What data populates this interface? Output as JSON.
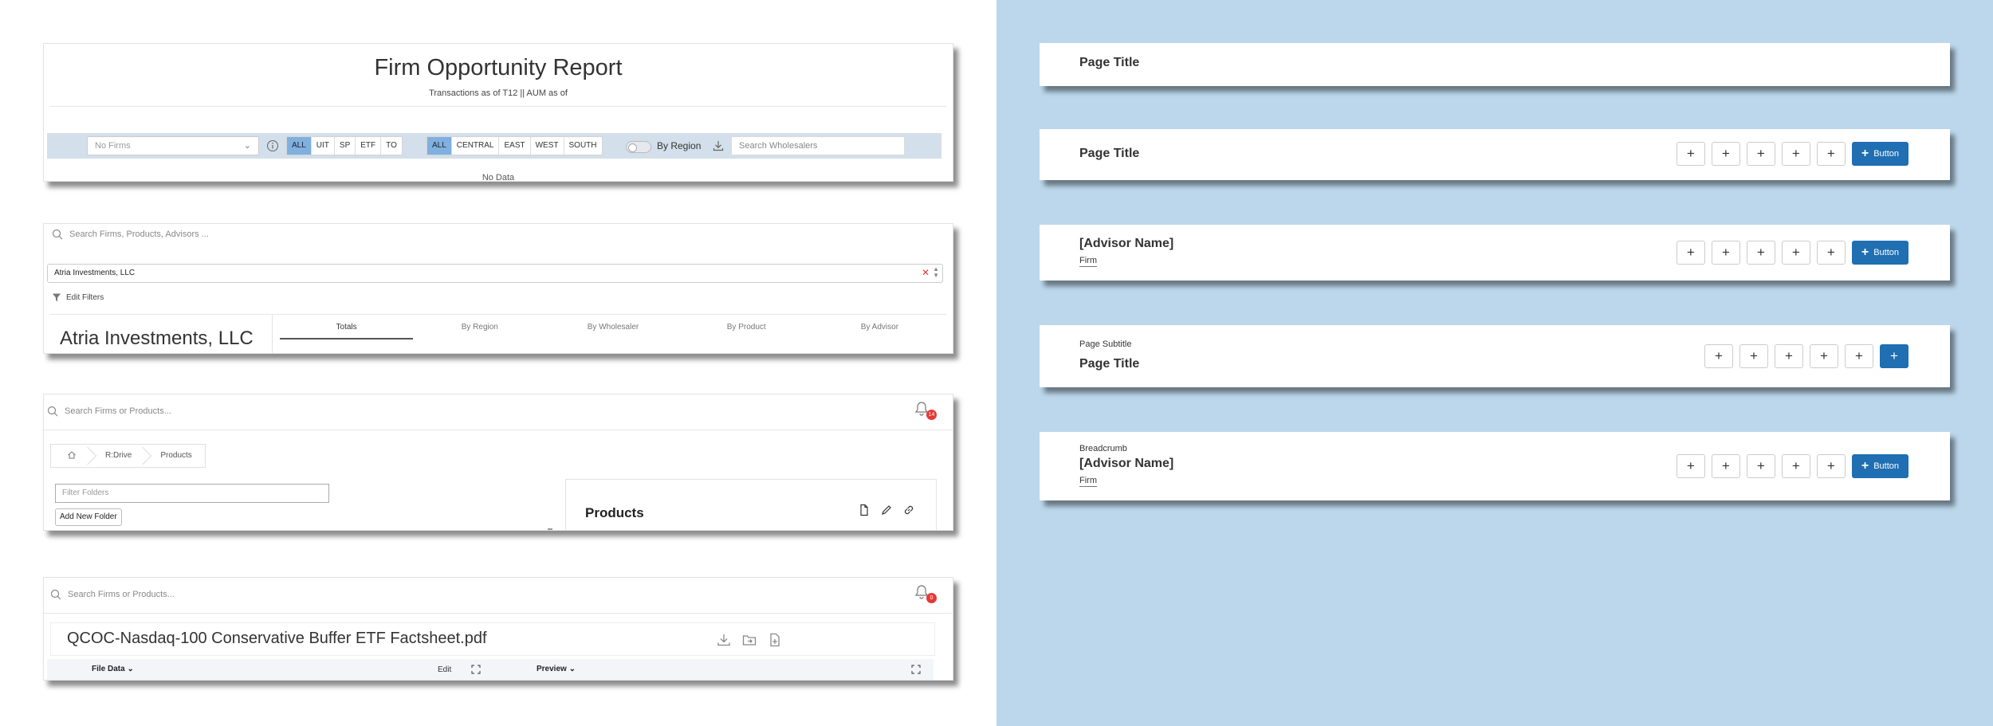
{
  "report": {
    "title": "Firm Opportunity Report",
    "subtitle": "Transactions as of T12 || AUM as of",
    "firm_select_placeholder": "No Firms",
    "product_filters": [
      "ALL",
      "UIT",
      "SP",
      "ETF",
      "TO"
    ],
    "region_filters": [
      "ALL",
      "CENTRAL",
      "EAST",
      "WEST",
      "SOUTH"
    ],
    "by_region_label": "By Region",
    "wholesaler_search_placeholder": "Search Wholesalers",
    "no_data": "No Data"
  },
  "firm_view": {
    "search_placeholder": "Search Firms, Products, Advisors ...",
    "selected_firm": "Atria Investments, LLC",
    "edit_filters": "Edit Filters",
    "firm_name": "Atria Investments, LLC",
    "tabs": [
      "Totals",
      "By Region",
      "By Wholesaler",
      "By Product",
      "By Advisor"
    ]
  },
  "drive": {
    "search_placeholder": "Search Firms or Products...",
    "notification_count": "14",
    "breadcrumbs": [
      "R:Drive",
      "Products"
    ],
    "filter_placeholder": "Filter Folders",
    "add_folder": "Add New Folder",
    "panel_title": "Products"
  },
  "file_view": {
    "search_placeholder": "Search Firms or Products...",
    "notification_count": "0",
    "file_name": "QCOC-Nasdaq-100 Conservative Buffer ETF Factsheet.pdf",
    "file_data": "File Data",
    "edit": "Edit",
    "preview": "Preview"
  },
  "headers": {
    "h1": {
      "title": "Page Title"
    },
    "h2": {
      "title": "Page Title",
      "button": "Button"
    },
    "h3": {
      "title": "[Advisor Name]",
      "firm": "Firm",
      "button": "Button"
    },
    "h4": {
      "subtitle": "Page Subtitle",
      "title": "Page Title"
    },
    "h5": {
      "breadcrumb": "Breadcrumb",
      "title": "[Advisor Name]",
      "firm": "Firm",
      "button": "Button"
    },
    "plus_symbol": "+"
  },
  "colors": {
    "right_background": "#bcd7ec",
    "primary_button": "#1f6fb2",
    "active_filter": "#7fb0df",
    "filter_bar": "#d3dfea",
    "badge": "#e53935"
  }
}
